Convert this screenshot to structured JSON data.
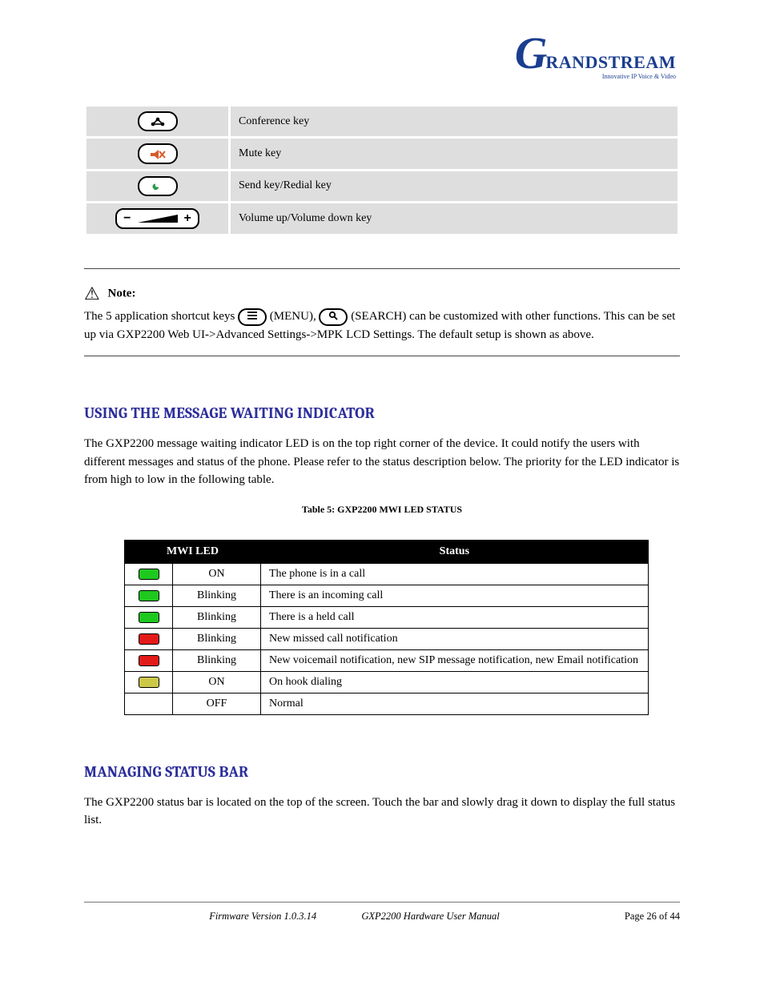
{
  "logo": {
    "brand": "Grandstream",
    "tagline": "Innovative IP Voice & Video"
  },
  "hw_table": {
    "rows": [
      {
        "name": "conference-key",
        "desc": "Conference key"
      },
      {
        "name": "mute-key",
        "desc": "Mute key"
      },
      {
        "name": "send-redial-key",
        "desc": "Send key/Redial key"
      },
      {
        "name": "volume-key",
        "desc": "Volume up/Volume down key"
      }
    ]
  },
  "note": {
    "head": "Note:",
    "body_before_icon1": "The 5 application shortcut keys ",
    "body_mid": " (MENU), ",
    "body_after_icon2": " (SEARCH) can be customized with other functions. This can be set up via GXP2200 Web UI->Advanced Settings->MPK LCD Settings. The default setup is shown as above.",
    "icon1_name": "menu-key-icon",
    "icon2_name": "search-key-icon"
  },
  "section_mwi": {
    "title": "USING THE MESSAGE WAITING INDICATOR",
    "intro": "The GXP2200 message waiting indicator LED is on the top right corner of the device. It could notify the users with different messages and status of the phone. Please refer to the status description below. The priority for the LED indicator is from high to low in the following table.",
    "table_caption": "Table 5: GXP2200 MWI LED STATUS",
    "table": [
      {
        "color": "green",
        "pattern": "ON",
        "status": "The phone is in a call"
      },
      {
        "color": "green",
        "pattern": "Blinking",
        "status": "There is an incoming call"
      },
      {
        "color": "green",
        "pattern": "Blinking",
        "status": "There is a held call"
      },
      {
        "color": "red",
        "pattern": "Blinking",
        "status": "New missed call notification"
      },
      {
        "color": "red",
        "pattern": "Blinking",
        "status": "New voicemail notification, new SIP message notification, new Email notification"
      },
      {
        "color": "amber",
        "pattern": "ON",
        "status": "On hook dialing"
      },
      {
        "color": "",
        "pattern": "OFF",
        "status": "Normal"
      }
    ]
  },
  "section_status": {
    "title": "MANAGING STATUS BAR",
    "body": "The GXP2200 status bar is located on the top of the screen. Touch the bar and slowly drag it down to display the full status list."
  },
  "footer": {
    "line1": "Firmware Version 1.0.3.14",
    "line2": "GXP2200 Hardware User Manual",
    "page": "Page 26 of 44"
  }
}
